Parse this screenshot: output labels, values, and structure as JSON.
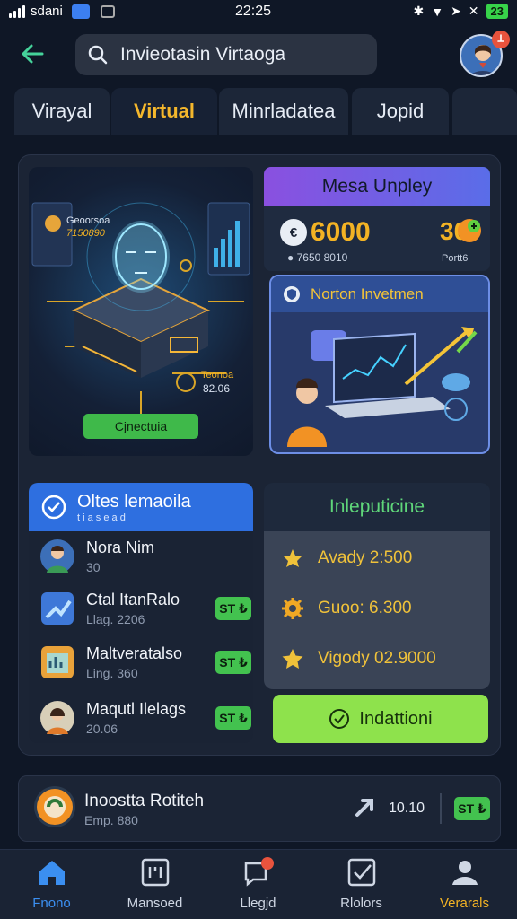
{
  "status_bar": {
    "carrier": "sdani",
    "time": "22:25",
    "battery": "23"
  },
  "header": {
    "search_value": "Invieotasin Virtaoga",
    "notification_count": ""
  },
  "tabs": [
    {
      "label": "Virayal",
      "active": false
    },
    {
      "label": "Virtual",
      "active": true
    },
    {
      "label": "Minrladatea",
      "active": false
    },
    {
      "label": "Jopid",
      "active": false
    }
  ],
  "hero": {
    "stat_label": "Geoorsoa",
    "stat_value": "7150890",
    "side_label": "Teonoa",
    "side_value": "82.06",
    "button_label": "Cjnectuia"
  },
  "balance": {
    "title": "Mesa Unpley",
    "coin_symbol": "€",
    "amount": "6000",
    "side_amount": "30",
    "sub": "7650 8010",
    "side_label": "Portt6"
  },
  "investment": {
    "title": "Norton Invetmen"
  },
  "list": {
    "title": "Oltes lemaoila",
    "subtitle": "t i a s e a d",
    "items": [
      {
        "name": "Nora Nim",
        "meta": "30",
        "badge": ""
      },
      {
        "name": "Ctal ItanRalo",
        "meta": "Llag. 2206",
        "badge": "ST ₺"
      },
      {
        "name": "Maltveratalso",
        "meta": "Ling. 360",
        "badge": "ST ₺"
      },
      {
        "name": "Maqutl Ilelags",
        "meta": "20.06",
        "badge": "ST ₺"
      }
    ]
  },
  "stats": {
    "title": "Inleputicine",
    "rows": [
      {
        "label": "Avady 2:500",
        "icon": "star-cluster-icon"
      },
      {
        "label": "Guoo: 6.300",
        "icon": "gear-badge-icon"
      },
      {
        "label": "Vigody 02.9000",
        "icon": "star-icon"
      }
    ],
    "action_label": "Indattioni"
  },
  "bottom_card": {
    "title": "Inoostta Rotiteh",
    "meta": "Emp. 880",
    "value": "10.10",
    "badge": "ST ₺"
  },
  "nav": [
    {
      "label": "Fnono",
      "icon": "home-icon"
    },
    {
      "label": "Mansoed",
      "icon": "ledger-icon"
    },
    {
      "label": "Llegjd",
      "icon": "chat-icon"
    },
    {
      "label": "Rlolors",
      "icon": "checklist-icon"
    },
    {
      "label": "Verarals",
      "icon": "profile-icon"
    }
  ],
  "colors": {
    "accent": "#f4b72c",
    "primary": "#2e6fe0",
    "success": "#43c24f",
    "background": "#0f1726"
  }
}
